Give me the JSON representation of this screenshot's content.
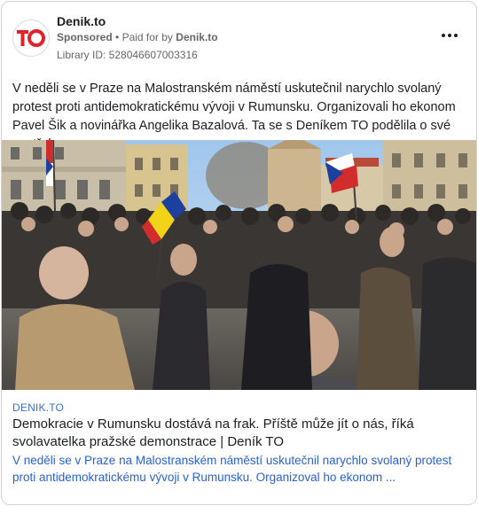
{
  "header": {
    "page_name": "Denik.to",
    "sponsored": "Sponsored",
    "separator": "•",
    "paid_for_prefix": "Paid for by",
    "paid_for_name": "Denik.to",
    "library_id": "Library ID: 528046607003316",
    "logo_text": "TO"
  },
  "post": {
    "text": "V neděli se v Praze na Malostranském náměstí uskutečnil narychlo svolaný protest proti antidemokratickému vývoji v Rumunsku. Organizovali ho ekonom Pavel Šik a novinářka Angelika Bazalová. Ta se s Deníkem TO podělila o své postřehy."
  },
  "link_preview": {
    "domain": "DENIK.TO",
    "title": "Demokracie v Rumunsku dostává na frak. Příště může jít o nás, říká svolavatelka pražské demonstrace | Deník TO",
    "description": "V neděli se v Praze na Malostranském náměstí uskutečnil narychlo svolaný protest proti antidemokratickému vývoji v Rumunsku. Organizoval ho ekonom ..."
  },
  "colors": {
    "logo_red": "#e3212b",
    "link_blue": "#2a63d0",
    "meta_gray": "#65676b"
  }
}
